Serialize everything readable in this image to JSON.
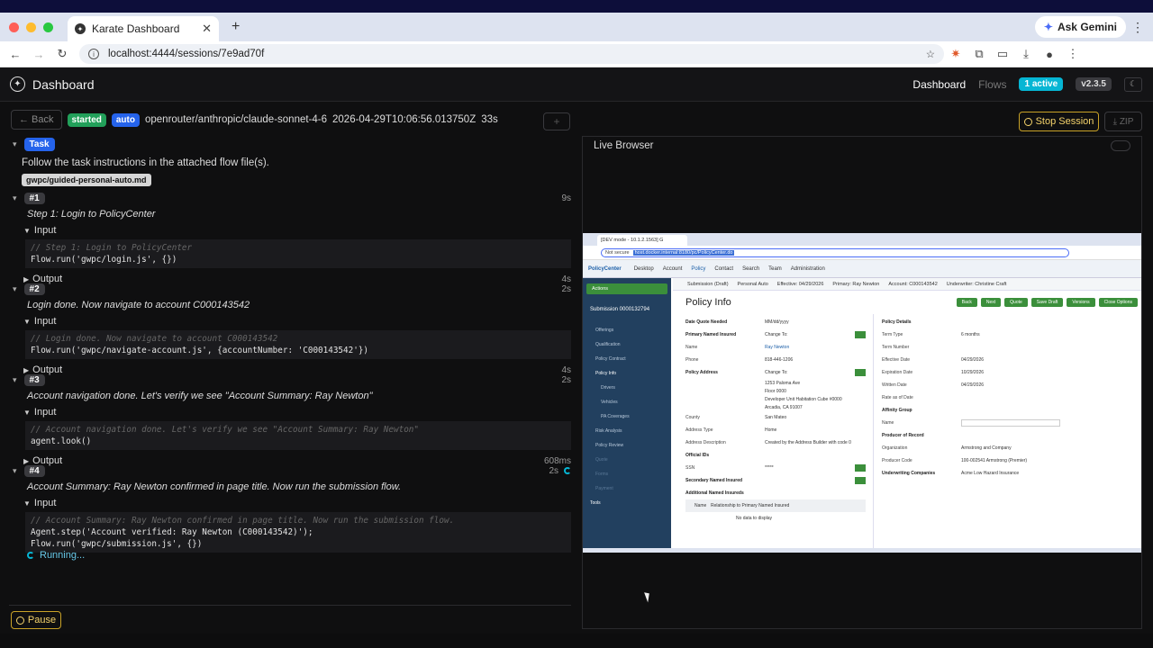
{
  "browser": {
    "tab_title": "Karate Dashboard",
    "url": "localhost:4444/sessions/7e9ad70f",
    "gemini_label": "Ask Gemini"
  },
  "header": {
    "app_title": "Dashboard",
    "nav_dashboard": "Dashboard",
    "nav_flows": "Flows",
    "active_badge": "1 active",
    "version": "v2.3.5"
  },
  "session": {
    "back_label": "← Back",
    "status": "started",
    "mode": "auto",
    "model": "openrouter/anthropic/claude-sonnet-4-6",
    "timestamp": "2026-04-29T10:06:56.013750Z",
    "elapsed": "33s",
    "stop_label": "Stop Session",
    "zip_label": "ZIP"
  },
  "task": {
    "label": "Task",
    "text": "Follow the task instructions in the attached flow file(s).",
    "file": "gwpc/guided-personal-auto.md"
  },
  "steps": [
    {
      "num": "#1",
      "duration": "9s",
      "desc": "Step 1: Login to PolicyCenter",
      "input_label": "Input",
      "code_comment": "// Step 1: Login to PolicyCenter",
      "code_lines": [
        "Flow.run('gwpc/login.js', {})"
      ],
      "output_label": "Output",
      "output_duration": "4s"
    },
    {
      "num": "#2",
      "duration": "2s",
      "desc": "Login done. Now navigate to account C000143542",
      "input_label": "Input",
      "code_comment": "// Login done. Now navigate to account C000143542",
      "code_lines": [
        "Flow.run('gwpc/navigate-account.js', {accountNumber: 'C000143542'})"
      ],
      "output_label": "Output",
      "output_duration": "4s"
    },
    {
      "num": "#3",
      "duration": "2s",
      "desc": "Account navigation done. Let's verify we see \"Account Summary: Ray Newton\"",
      "input_label": "Input",
      "code_comment": "// Account navigation done. Let's verify we see \"Account Summary: Ray Newton\"",
      "code_lines": [
        "agent.look()"
      ],
      "output_label": "Output",
      "output_duration": "608ms"
    },
    {
      "num": "#4",
      "duration": "2s",
      "desc": "Account Summary: Ray Newton confirmed in page title. Now run the submission flow.",
      "input_label": "Input",
      "code_comment": "// Account Summary: Ray Newton confirmed in page title. Now run the submission flow.",
      "code_lines": [
        "Agent.step('Account verified: Ray Newton (C000143542)');",
        "Flow.run('gwpc/submission.js', {})"
      ]
    }
  ],
  "running_label": "Running...",
  "pause_label": "Pause",
  "live_browser": {
    "title": "Live Browser",
    "inner_tab": "[DEV mode - 10.1.2.1563] G",
    "inner_url_prefix": "Not secure",
    "inner_url": "host.docker.internal:8180/pc/PolicyCenter.do",
    "pc_brand": "PolicyCenter",
    "pc_nav": [
      "Desktop",
      "Account",
      "Policy",
      "Contact",
      "Search",
      "Team",
      "Administration"
    ],
    "sidebar_actions": "Actions",
    "submission_no": "Submission 0000132794",
    "sidebar_items": [
      "Offerings",
      "Qualification",
      "Policy Contract",
      "Policy Info",
      "Drivers",
      "Vehicles",
      "PA Coverages",
      "Risk Analysis",
      "Policy Review",
      "Quote",
      "Forms",
      "Payment"
    ],
    "status_bar": [
      "Submission (Draft)",
      "Personal Auto",
      "Effective: 04/29/2026",
      "Primary: Ray Newton",
      "Account: C000143542",
      "Underwriter: Christine Craft"
    ],
    "page_title": "Policy Info",
    "buttons": [
      "Back",
      "Next",
      "Quote",
      "Save Draft",
      "Versions",
      "Close Options"
    ],
    "left_fields": [
      {
        "label": "Date Quote Needed",
        "value": "MM/dd/yyyy"
      },
      {
        "label": "Primary Named Insured",
        "value": "Change To:"
      },
      {
        "label": "Name",
        "value": "Ray Newton"
      },
      {
        "label": "Phone",
        "value": "818-446-1206"
      },
      {
        "label": "Policy Address",
        "value": "Change To:"
      },
      {
        "label": "",
        "value": "1253 Paloma Ave"
      },
      {
        "label": "",
        "value": "Floor 0000"
      },
      {
        "label": "",
        "value": "Developer Unit Habitation Cube #0000"
      },
      {
        "label": "",
        "value": "Arcadia, CA 91007"
      },
      {
        "label": "County",
        "value": "San Mateo"
      },
      {
        "label": "Address Type",
        "value": "Home"
      },
      {
        "label": "Address Description",
        "value": "Created by the Address Builder with code 0"
      },
      {
        "label": "Official IDs",
        "value": ""
      },
      {
        "label": "SSN",
        "value": "*****"
      },
      {
        "label": "Secondary Named Insured",
        "value": ""
      },
      {
        "label": "Additional Named Insureds",
        "value": ""
      }
    ],
    "right_fields": [
      {
        "label": "Policy Details",
        "value": ""
      },
      {
        "label": "Term Type",
        "value": "6 months"
      },
      {
        "label": "Term Number",
        "value": ""
      },
      {
        "label": "Effective Date",
        "value": "04/29/2026"
      },
      {
        "label": "Expiration Date",
        "value": "10/29/2026"
      },
      {
        "label": "Written Date",
        "value": "04/29/2026"
      },
      {
        "label": "Rate as of Date",
        "value": ""
      },
      {
        "label": "Affinity Group",
        "value": ""
      },
      {
        "label": "Name",
        "value": ""
      },
      {
        "label": "Producer of Record",
        "value": ""
      },
      {
        "label": "Organization",
        "value": "Armstrong and Company"
      },
      {
        "label": "Producer Code",
        "value": "100-002541 Armstrong (Premier)"
      },
      {
        "label": "Underwriting Companies",
        "value": "Acme Low Hazard Insurance"
      }
    ],
    "table_cols": [
      "Name",
      "Relationship to Primary Named Insured"
    ],
    "no_data": "No data to display",
    "tools": "Tools"
  }
}
